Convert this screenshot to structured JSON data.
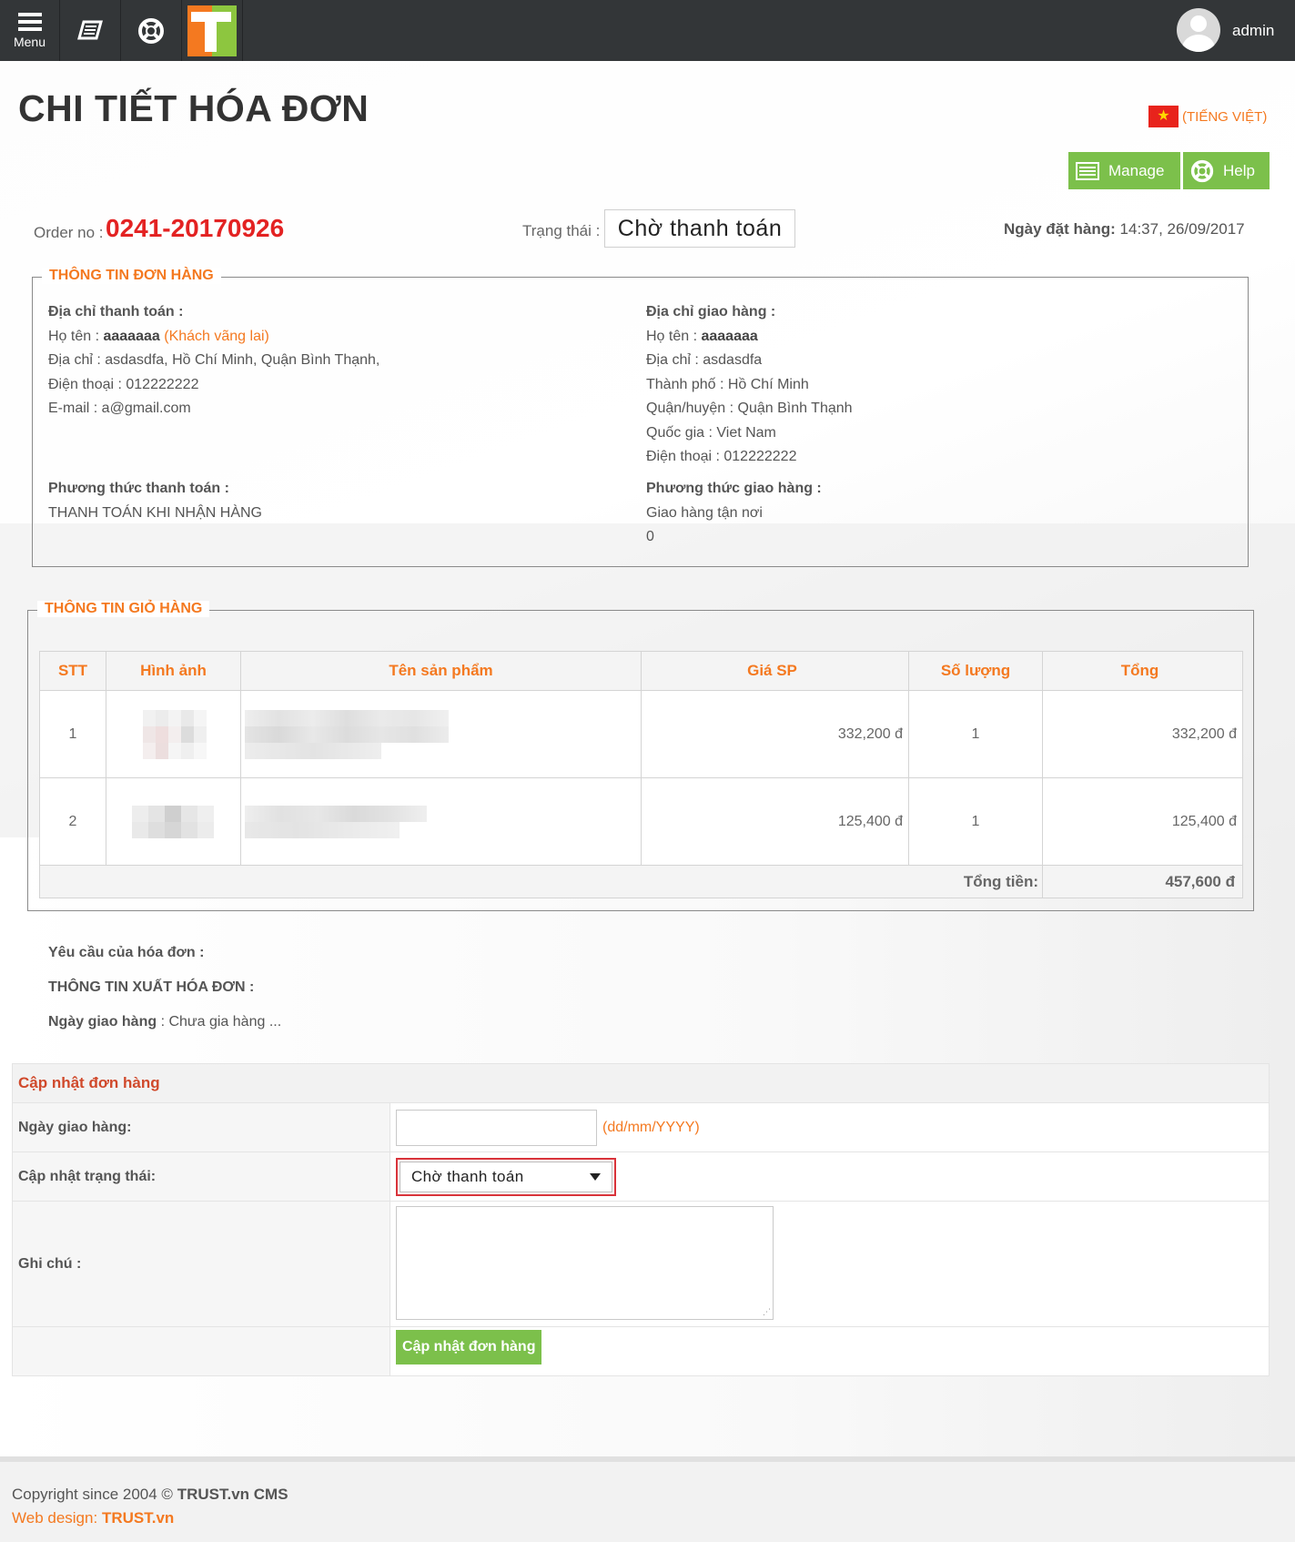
{
  "topbar": {
    "menu_label": "Menu",
    "icons": [
      "menu-icon",
      "book-icon",
      "lifebuoy-icon",
      "trust-logo"
    ],
    "user_name": "admin"
  },
  "header": {
    "title": "CHI TIẾT HÓA ĐƠN",
    "language": "(TIẾNG VIỆT)",
    "manage_label": "Manage",
    "help_label": "Help"
  },
  "order": {
    "order_no_label": "Order no :",
    "order_no": "0241-20170926",
    "status_label": "Trạng thái :",
    "status": "Chờ thanh toán",
    "date_label": "Ngày đặt hàng:",
    "date": "14:37, 26/09/2017"
  },
  "order_info": {
    "legend": "THÔNG TIN ĐƠN HÀNG",
    "billing": {
      "heading": "Địa chỉ thanh toán :",
      "name_label": "Họ tên :",
      "name": "aaaaaaa",
      "name_note": "(Khách vãng lai)",
      "address": "Địa chỉ : asdasdfa, Hồ Chí Minh, Quận Bình Thạnh,",
      "phone": "Điện thoại : 012222222",
      "email": "E-mail : a@gmail.com"
    },
    "shipping": {
      "heading": "Địa chỉ giao hàng :",
      "name_label": "Họ tên :",
      "name": "aaaaaaa",
      "address": "Địa chỉ : asdasdfa",
      "city": "Thành phố : Hồ Chí Minh",
      "district": "Quận/huyện : Quận Bình Thạnh",
      "country": "Quốc gia : Viet Nam",
      "phone": "Điện thoại : 012222222"
    },
    "payment_method_heading": "Phương thức thanh toán :",
    "payment_method": "THANH TOÁN KHI NHẬN HÀNG",
    "shipping_method_heading": "Phương thức giao hàng :",
    "shipping_method": "Giao hàng tận nơi",
    "shipping_fee": "0"
  },
  "cart": {
    "legend": "THÔNG TIN GIỎ HÀNG",
    "columns": [
      "STT",
      "Hình ảnh",
      "Tên sản phẩm",
      "Giá SP",
      "Số lượng",
      "Tổng"
    ],
    "rows": [
      {
        "stt": "1",
        "price": "332,200 đ",
        "qty": "1",
        "total": "332,200 đ"
      },
      {
        "stt": "2",
        "price": "125,400 đ",
        "qty": "1",
        "total": "125,400 đ"
      }
    ],
    "total_label": "Tổng tiền:",
    "total_value": "457,600 đ"
  },
  "extra": {
    "request_label": "Yêu cầu của hóa đơn :",
    "invoice_label": "THÔNG TIN XUẤT HÓA ĐƠN :",
    "delivery_label": "Ngày giao hàng",
    "delivery_value": ": Chưa gia hàng ..."
  },
  "update_form": {
    "title": "Cập nhật đơn hàng",
    "delivery_date_label": "Ngày giao hàng:",
    "delivery_date_value": "",
    "date_hint": "(dd/mm/YYYY)",
    "status_label": "Cập nhật trạng thái:",
    "status_selected": "Chờ thanh toán",
    "note_label": "Ghi chú :",
    "note_value": "",
    "submit_label": "Cập nhật đơn hàng"
  },
  "footer": {
    "copyright_prefix": "Copyright since 2004 ©",
    "copyright_brand": "TRUST.vn CMS",
    "webdesign_label": "Web design:",
    "webdesign_brand": "TRUST.vn"
  },
  "colors": {
    "topbar": "#333638",
    "accent_orange": "#f47920",
    "order_red": "#e32222",
    "button_green": "#7cc04b",
    "highlight_red": "#d9333a"
  }
}
